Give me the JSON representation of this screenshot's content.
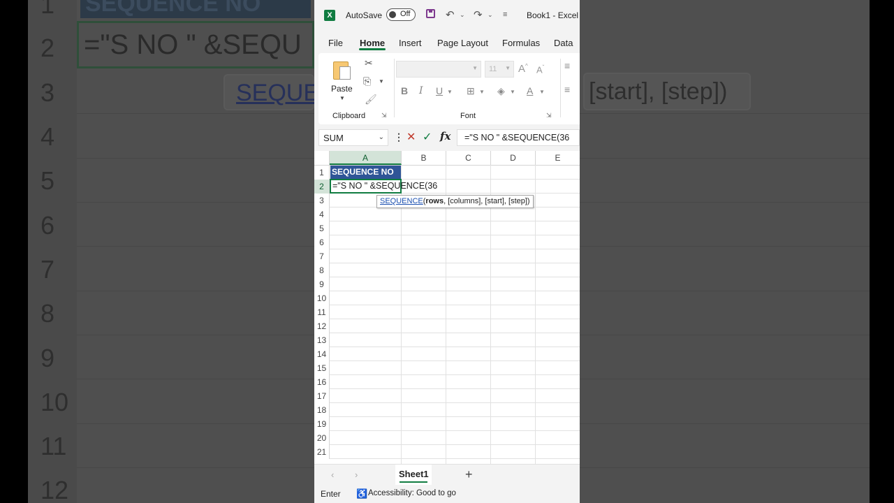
{
  "background": {
    "header_text": "SEQUENCE NO",
    "formula_text": "=\"S NO \" &SEQU",
    "tip_left": "SEQUE",
    "tip_right": "[start], [step])",
    "row_numbers": [
      "1",
      "2",
      "3",
      "4",
      "5",
      "6",
      "7",
      "8",
      "9",
      "10",
      "11",
      "12"
    ]
  },
  "titlebar": {
    "autosave_label": "AutoSave",
    "toggle_state": "Off",
    "book_title": "Book1 - Excel"
  },
  "menu": {
    "items": [
      "File",
      "Home",
      "Insert",
      "Page Layout",
      "Formulas",
      "Data"
    ],
    "active": "Home"
  },
  "ribbon": {
    "paste_label": "Paste",
    "clipboard_group": "Clipboard",
    "font_group": "Font",
    "font_size": "11"
  },
  "formula_bar": {
    "name_box": "SUM",
    "formula": "=\"S NO \" &SEQUENCE(36"
  },
  "grid": {
    "columns": [
      "A",
      "B",
      "C",
      "D",
      "E"
    ],
    "rows": [
      "1",
      "2",
      "3",
      "4",
      "5",
      "6",
      "7",
      "8",
      "9",
      "10",
      "11",
      "12",
      "13",
      "14",
      "15",
      "16",
      "17",
      "18",
      "19",
      "20",
      "21"
    ],
    "cells": {
      "A1": "SEQUENCE NO",
      "A2": "=\"S NO \" &SEQUENCE(36"
    },
    "tooltip": {
      "function": "SEQUENCE",
      "open_paren": "(",
      "current_arg": "rows",
      "rest": ", [columns], [start], [step])"
    }
  },
  "tabs": {
    "sheet": "Sheet1",
    "add": "+"
  },
  "status": {
    "mode": "Enter",
    "accessibility": "Accessibility: Good to go"
  },
  "colors": {
    "accent": "#107c41",
    "header_fill": "#2f5597"
  }
}
